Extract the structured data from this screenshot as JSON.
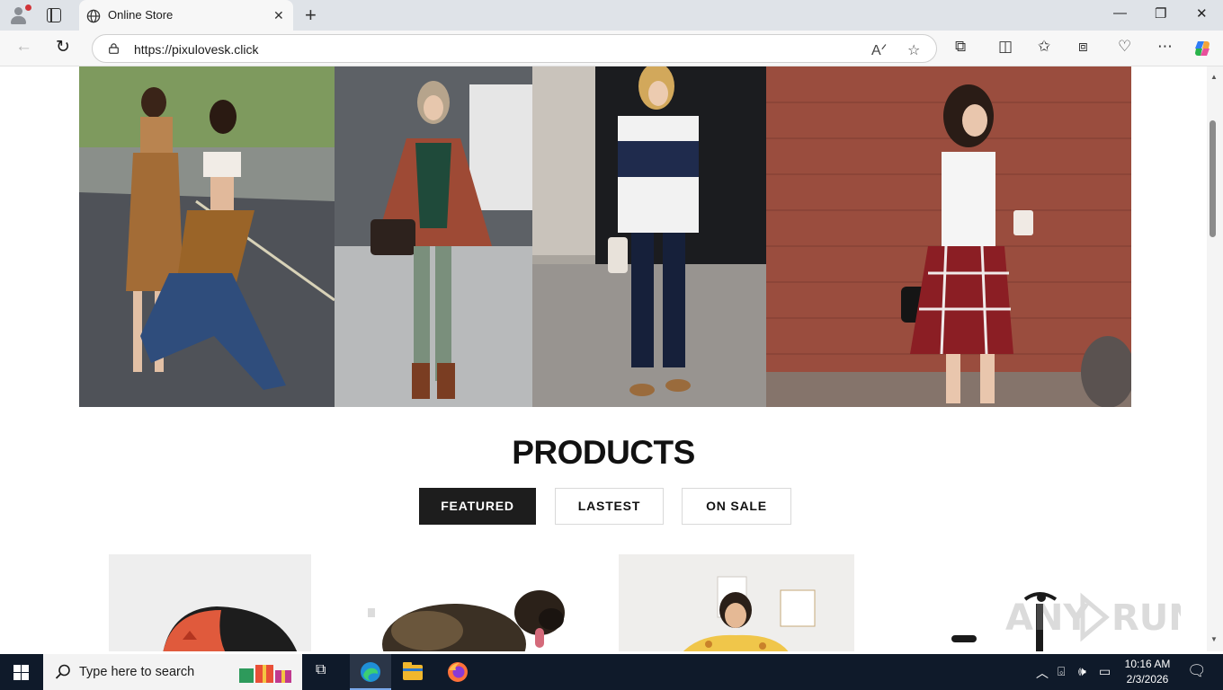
{
  "browser": {
    "tab_title": "Online Store",
    "url": "https://pixulovesk.click",
    "colors": {
      "titlebar": "#dfe3e8",
      "toolbar": "#f7f7f7"
    }
  },
  "page": {
    "section_title": "PRODUCTS",
    "filters": [
      {
        "label": "FEATURED",
        "active": true
      },
      {
        "label": "LASTEST",
        "active": false
      },
      {
        "label": "ON SALE",
        "active": false
      }
    ],
    "hero_images": [
      "street-style-photo-1",
      "street-style-photo-2",
      "street-style-photo-3",
      "street-style-photo-4"
    ],
    "product_images": [
      "cap-product",
      "dog-product",
      "kids-blanket-product",
      "scooter-product"
    ]
  },
  "taskbar": {
    "search_placeholder": "Type here to search",
    "time": "10:16 AM",
    "date": "2/3/2026"
  }
}
